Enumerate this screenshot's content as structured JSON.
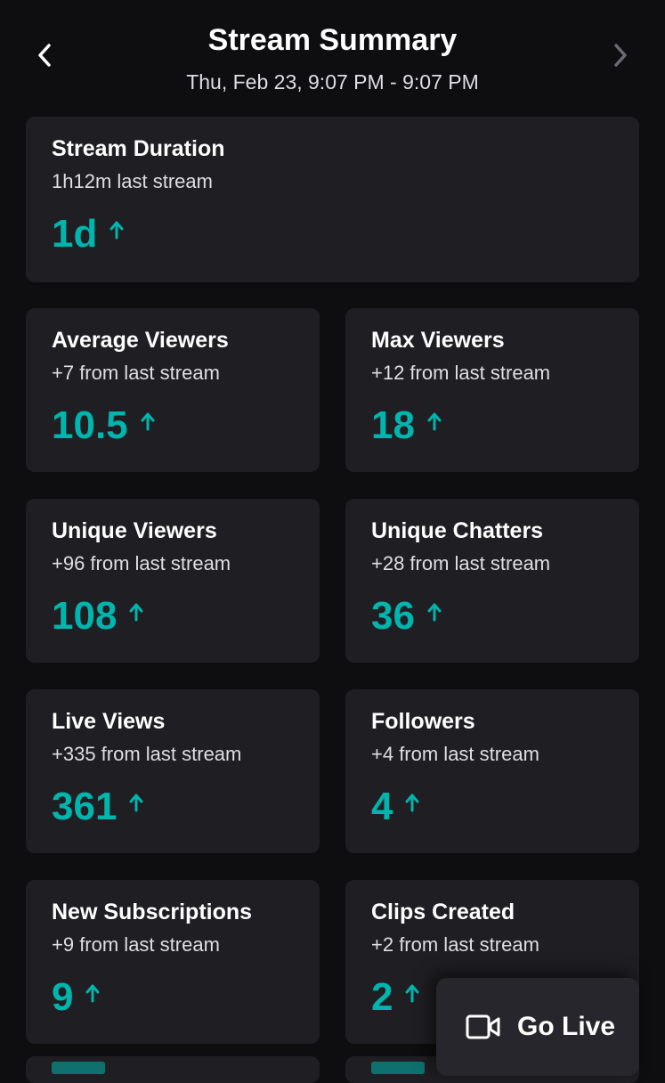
{
  "header": {
    "title": "Stream Summary",
    "subtitle": "Thu, Feb 23, 9:07 PM - 9:07 PM",
    "back_icon": "chevron-left-icon",
    "forward_icon": "chevron-right-icon"
  },
  "colors": {
    "accent": "#00b5ad",
    "card_bg": "#1f1f23",
    "page_bg": "#0e0e10"
  },
  "stats": [
    {
      "label": "Stream Duration",
      "sub": "1h12m last stream",
      "value": "1d",
      "trend": "up"
    },
    {
      "label": "Average Viewers",
      "sub": "+7 from last stream",
      "value": "10.5",
      "trend": "up"
    },
    {
      "label": "Max Viewers",
      "sub": "+12 from last stream",
      "value": "18",
      "trend": "up"
    },
    {
      "label": "Unique Viewers",
      "sub": "+96 from last stream",
      "value": "108",
      "trend": "up"
    },
    {
      "label": "Unique Chatters",
      "sub": "+28 from last stream",
      "value": "36",
      "trend": "up"
    },
    {
      "label": "Live Views",
      "sub": "+335 from last stream",
      "value": "361",
      "trend": "up"
    },
    {
      "label": "Followers",
      "sub": "+4 from last stream",
      "value": "4",
      "trend": "up"
    },
    {
      "label": "New Subscriptions",
      "sub": "+9 from last stream",
      "value": "9",
      "trend": "up"
    },
    {
      "label": "Clips Created",
      "sub": "+2 from last stream",
      "value": "2",
      "trend": "up"
    }
  ],
  "go_live": {
    "label": "Go Live",
    "icon": "video-camera-icon"
  }
}
